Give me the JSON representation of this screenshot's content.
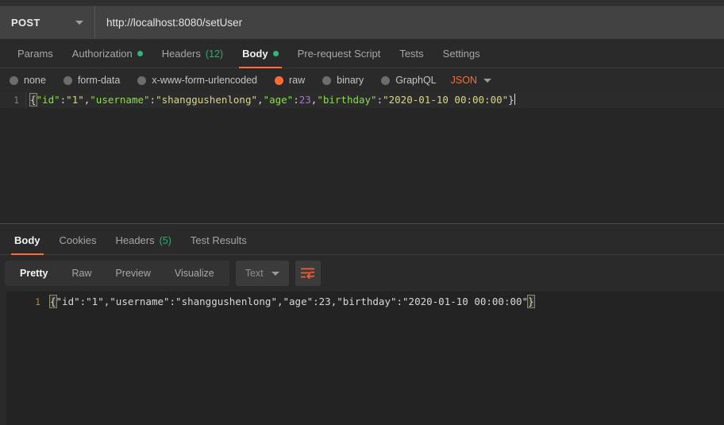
{
  "request": {
    "method": "POST",
    "method_caret": "chevron-down-icon",
    "url": "http://localhost:8080/setUser",
    "tabs": [
      {
        "label": "Params",
        "badge": "",
        "badge_type": "none",
        "active": false
      },
      {
        "label": "Authorization",
        "badge": "",
        "badge_type": "dot",
        "active": false
      },
      {
        "label": "Headers",
        "badge": "(12)",
        "badge_type": "count",
        "active": false
      },
      {
        "label": "Body",
        "badge": "",
        "badge_type": "dot",
        "active": true
      },
      {
        "label": "Pre-request Script",
        "badge": "",
        "badge_type": "none",
        "active": false
      },
      {
        "label": "Tests",
        "badge": "",
        "badge_type": "none",
        "active": false
      },
      {
        "label": "Settings",
        "badge": "",
        "badge_type": "none",
        "active": false
      }
    ],
    "body_types": [
      {
        "label": "none",
        "selected": false
      },
      {
        "label": "form-data",
        "selected": false
      },
      {
        "label": "x-www-form-urlencoded",
        "selected": false
      },
      {
        "label": "raw",
        "selected": true
      },
      {
        "label": "binary",
        "selected": false
      },
      {
        "label": "GraphQL",
        "selected": false
      }
    ],
    "raw_format": "JSON",
    "editor": {
      "line_number": "1",
      "tokens": [
        {
          "text": "{",
          "type": "bracket"
        },
        {
          "text": "\"id\"",
          "type": "key"
        },
        {
          "text": ":",
          "type": "punc"
        },
        {
          "text": "\"1\"",
          "type": "str"
        },
        {
          "text": ",",
          "type": "punc"
        },
        {
          "text": "\"username\"",
          "type": "key"
        },
        {
          "text": ":",
          "type": "punc"
        },
        {
          "text": "\"shanggushenlong\"",
          "type": "str"
        },
        {
          "text": ",",
          "type": "punc"
        },
        {
          "text": "\"age\"",
          "type": "key"
        },
        {
          "text": ":",
          "type": "punc"
        },
        {
          "text": "23",
          "type": "num"
        },
        {
          "text": ",",
          "type": "punc"
        },
        {
          "text": "\"birthday\"",
          "type": "key"
        },
        {
          "text": ":",
          "type": "punc"
        },
        {
          "text": "\"2020-01-10 00:00:00\"",
          "type": "str"
        },
        {
          "text": "}",
          "type": "punc"
        }
      ]
    }
  },
  "response": {
    "tabs": [
      {
        "label": "Body",
        "badge": "",
        "active": true
      },
      {
        "label": "Cookies",
        "badge": "",
        "active": false
      },
      {
        "label": "Headers",
        "badge": "(5)",
        "active": false
      },
      {
        "label": "Test Results",
        "badge": "",
        "active": false
      }
    ],
    "view_modes": [
      {
        "label": "Pretty",
        "active": true
      },
      {
        "label": "Raw",
        "active": false
      },
      {
        "label": "Preview",
        "active": false
      },
      {
        "label": "Visualize",
        "active": false
      }
    ],
    "format": "Text",
    "wrap_icon": "word-wrap-icon",
    "body": {
      "line_number": "1",
      "text": "{\"id\":\"1\",\"username\":\"shanggushenlong\",\"age\":23,\"birthday\":\"2020-01-10 00:00:00\"}"
    }
  },
  "colors": {
    "accent": "#ff6c37",
    "success": "#2eb67d",
    "json_key": "#8ddb4e",
    "json_string": "#d9d68a",
    "json_number": "#a477d4",
    "background": "#2a2a2a",
    "editor_background": "#262626"
  }
}
